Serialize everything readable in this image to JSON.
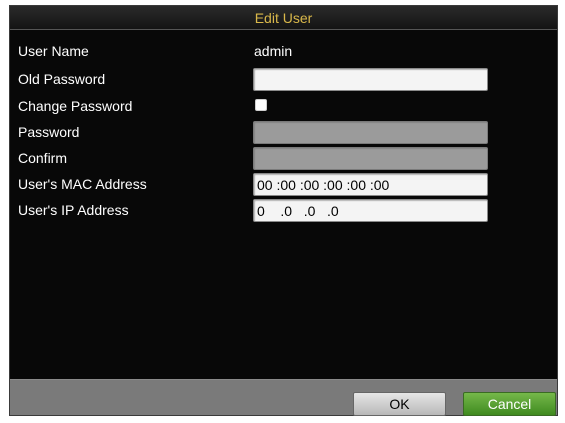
{
  "dialog": {
    "title": "Edit User"
  },
  "form": {
    "user_name_label": "User Name",
    "user_name_value": "admin",
    "old_password_label": "Old Password",
    "old_password_value": "",
    "change_password_label": "Change Password",
    "change_password_checked": false,
    "password_label": "Password",
    "password_value": "",
    "confirm_label": "Confirm",
    "confirm_value": "",
    "mac_label": "User's MAC Address",
    "mac_value": "00 :00 :00 :00 :00 :00",
    "ip_label": "User's IP Address",
    "ip_value": "0    .0   .0   .0"
  },
  "buttons": {
    "ok_label": "OK",
    "cancel_label": "Cancel"
  },
  "colors": {
    "title_text": "#d9b84a",
    "dialog_bg": "#080808",
    "footer_bg": "#7a7a7a",
    "cancel_bg": "#4f9a2b"
  }
}
